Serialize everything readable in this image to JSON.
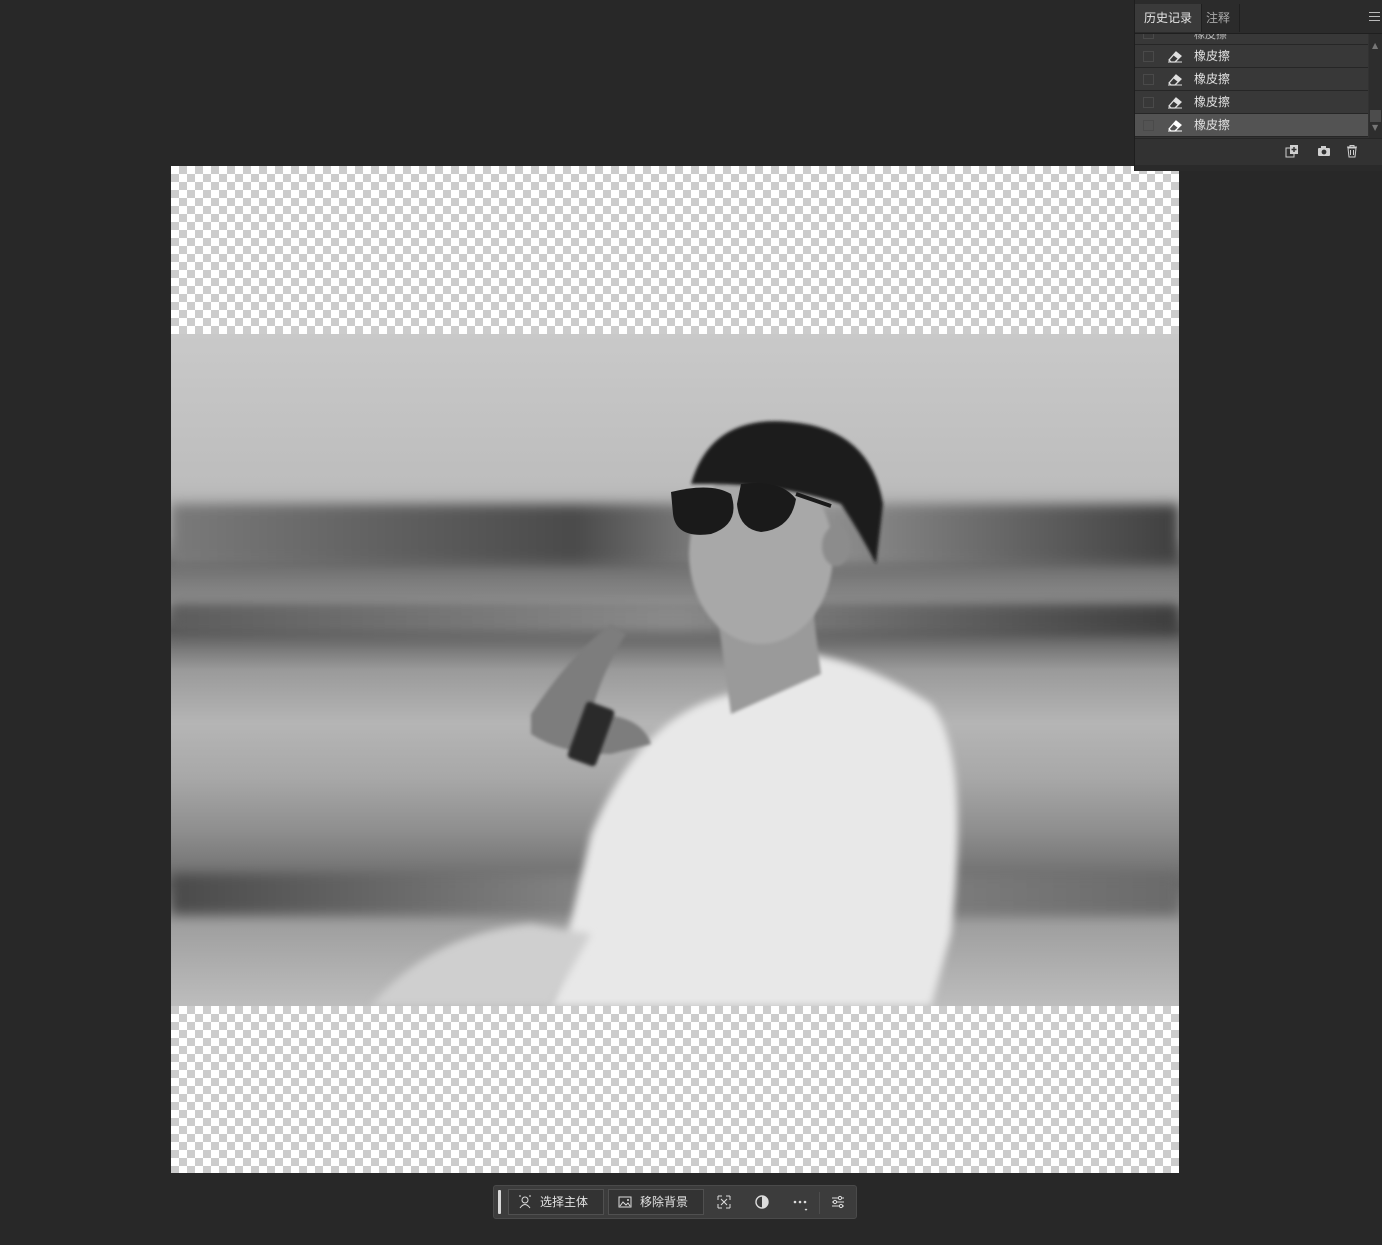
{
  "history_panel": {
    "tabs": [
      {
        "label": "历史记录",
        "active": true
      },
      {
        "label": "注释",
        "active": false
      }
    ],
    "partial_item_label": "橡皮擦",
    "items": [
      {
        "label": "橡皮擦",
        "icon": "eraser-icon",
        "selected": false
      },
      {
        "label": "橡皮擦",
        "icon": "eraser-icon",
        "selected": false
      },
      {
        "label": "橡皮擦",
        "icon": "eraser-icon",
        "selected": false
      },
      {
        "label": "橡皮擦",
        "icon": "eraser-icon",
        "selected": true
      }
    ],
    "footer_icons": [
      "new-document-from-state-icon",
      "camera-snapshot-icon",
      "trash-icon"
    ]
  },
  "canvas": {
    "background": "transparency-checkerboard",
    "image": "grayscale motion-blurred photo of a young man in sunglasses and white shirt"
  },
  "taskbar": {
    "select_subject_label": "选择主体",
    "remove_background_label": "移除背景",
    "icons": [
      "transform-selection-icon",
      "adjustment-icon",
      "more-icon",
      "properties-icon"
    ]
  },
  "colors": {
    "workspace": "#282828",
    "panel": "#323232",
    "selected_row": "#535353",
    "accent_text": "#e0e0e0"
  }
}
